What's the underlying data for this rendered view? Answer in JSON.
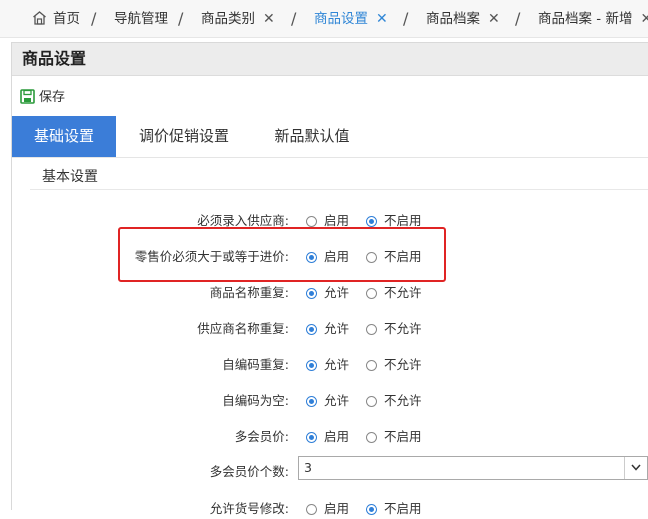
{
  "nav_tabs": [
    {
      "label": "首页"
    },
    {
      "label": "导航管理"
    },
    {
      "label": "商品类别",
      "closable": true
    },
    {
      "label": "商品设置",
      "closable": true,
      "active": true
    },
    {
      "label": "商品档案",
      "closable": true
    },
    {
      "label": "商品档案 - 新增",
      "closable": true
    }
  ],
  "close_glyph": "✕",
  "separator": "/",
  "page_title": "商品设置",
  "toolbar": {
    "save_label": "保存"
  },
  "sub_tabs": [
    {
      "label": "基础设置",
      "active": true
    },
    {
      "label": "调价促销设置"
    },
    {
      "label": "新品默认值"
    }
  ],
  "section_label": "基本设置",
  "settings": [
    {
      "label": "必须录入供应商:",
      "options": [
        "启用",
        "不启用"
      ],
      "selected": 1
    },
    {
      "label": "零售价必须大于或等于进价:",
      "options": [
        "启用",
        "不启用"
      ],
      "selected": 0,
      "highlighted": true
    },
    {
      "label": "商品名称重复:",
      "options": [
        "允许",
        "不允许"
      ],
      "selected": 0
    },
    {
      "label": "供应商名称重复:",
      "options": [
        "允许",
        "不允许"
      ],
      "selected": 0
    },
    {
      "label": "自编码重复:",
      "options": [
        "允许",
        "不允许"
      ],
      "selected": 0
    },
    {
      "label": "自编码为空:",
      "options": [
        "允许",
        "不允许"
      ],
      "selected": 0
    },
    {
      "label": "多会员价:",
      "options": [
        "启用",
        "不启用"
      ],
      "selected": 0
    }
  ],
  "multi_member_price_count": {
    "label": "多会员价个数:",
    "value": "3"
  },
  "allow_code_edit": {
    "label": "允许货号修改:",
    "options": [
      "启用",
      "不启用"
    ],
    "selected": 1
  },
  "colors": {
    "accent": "#3b7dd8",
    "highlight": "#e02424"
  },
  "icons": {
    "home": "home-icon",
    "save": "save-icon",
    "dropdown": "chevron-down-icon"
  }
}
